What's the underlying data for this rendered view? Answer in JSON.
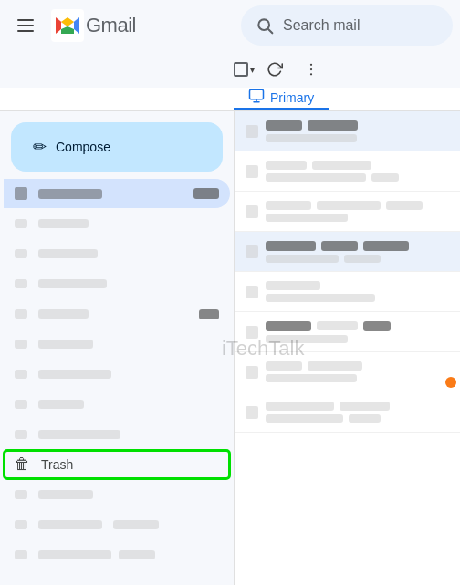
{
  "header": {
    "menu_icon": "☰",
    "gmail_label": "Gmail",
    "search_placeholder": "Search mail"
  },
  "toolbar": {
    "select_all_label": "Select all",
    "refresh_icon": "↻",
    "more_icon": "⋮"
  },
  "tabs": [
    {
      "id": "primary",
      "label": "Primary",
      "icon": "🖥",
      "active": true
    }
  ],
  "compose": {
    "label": "Compose",
    "icon": "✏"
  },
  "sidebar": {
    "items": [
      {
        "id": "inbox",
        "label": "Inbox",
        "badge": "",
        "blurred": true
      },
      {
        "id": "starred",
        "label": "",
        "blurred": true
      },
      {
        "id": "snoozed",
        "label": "",
        "blurred": true
      },
      {
        "id": "sent",
        "label": "",
        "blurred": true
      },
      {
        "id": "trash",
        "label": "Trash",
        "icon": "🗑",
        "highlighted": false,
        "trash": true
      }
    ]
  },
  "watermark": "iTechTalk",
  "email_list": {
    "items": [
      {
        "id": 1,
        "highlighted": true
      },
      {
        "id": 2
      },
      {
        "id": 3
      },
      {
        "id": 4
      },
      {
        "id": 5
      },
      {
        "id": 6
      },
      {
        "id": 7,
        "has_orange_dot": true
      },
      {
        "id": 8
      }
    ]
  }
}
